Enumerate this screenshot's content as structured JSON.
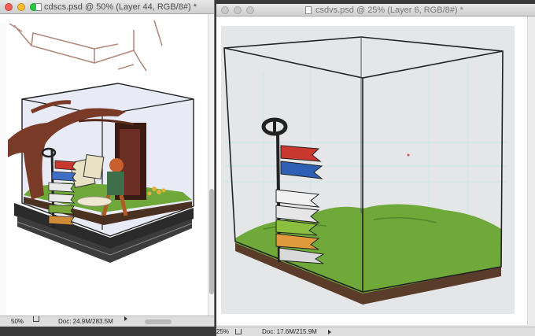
{
  "window_left": {
    "title": "cdscs.psd @ 50% (Layer 44, RGB/8#) *",
    "zoom": "50%",
    "doc_info": "Doc: 24.9M/283.5M"
  },
  "window_right": {
    "title": "csdvs.psd @ 25% (Layer 6, RGB/8#) *",
    "zoom": "25%",
    "doc_info": "Doc: 17.6M/215.9M"
  },
  "colors": {
    "close": "#fc5f57",
    "minimize": "#fdbc2e",
    "zoom": "#29c940",
    "status_bg": "#dedede"
  }
}
